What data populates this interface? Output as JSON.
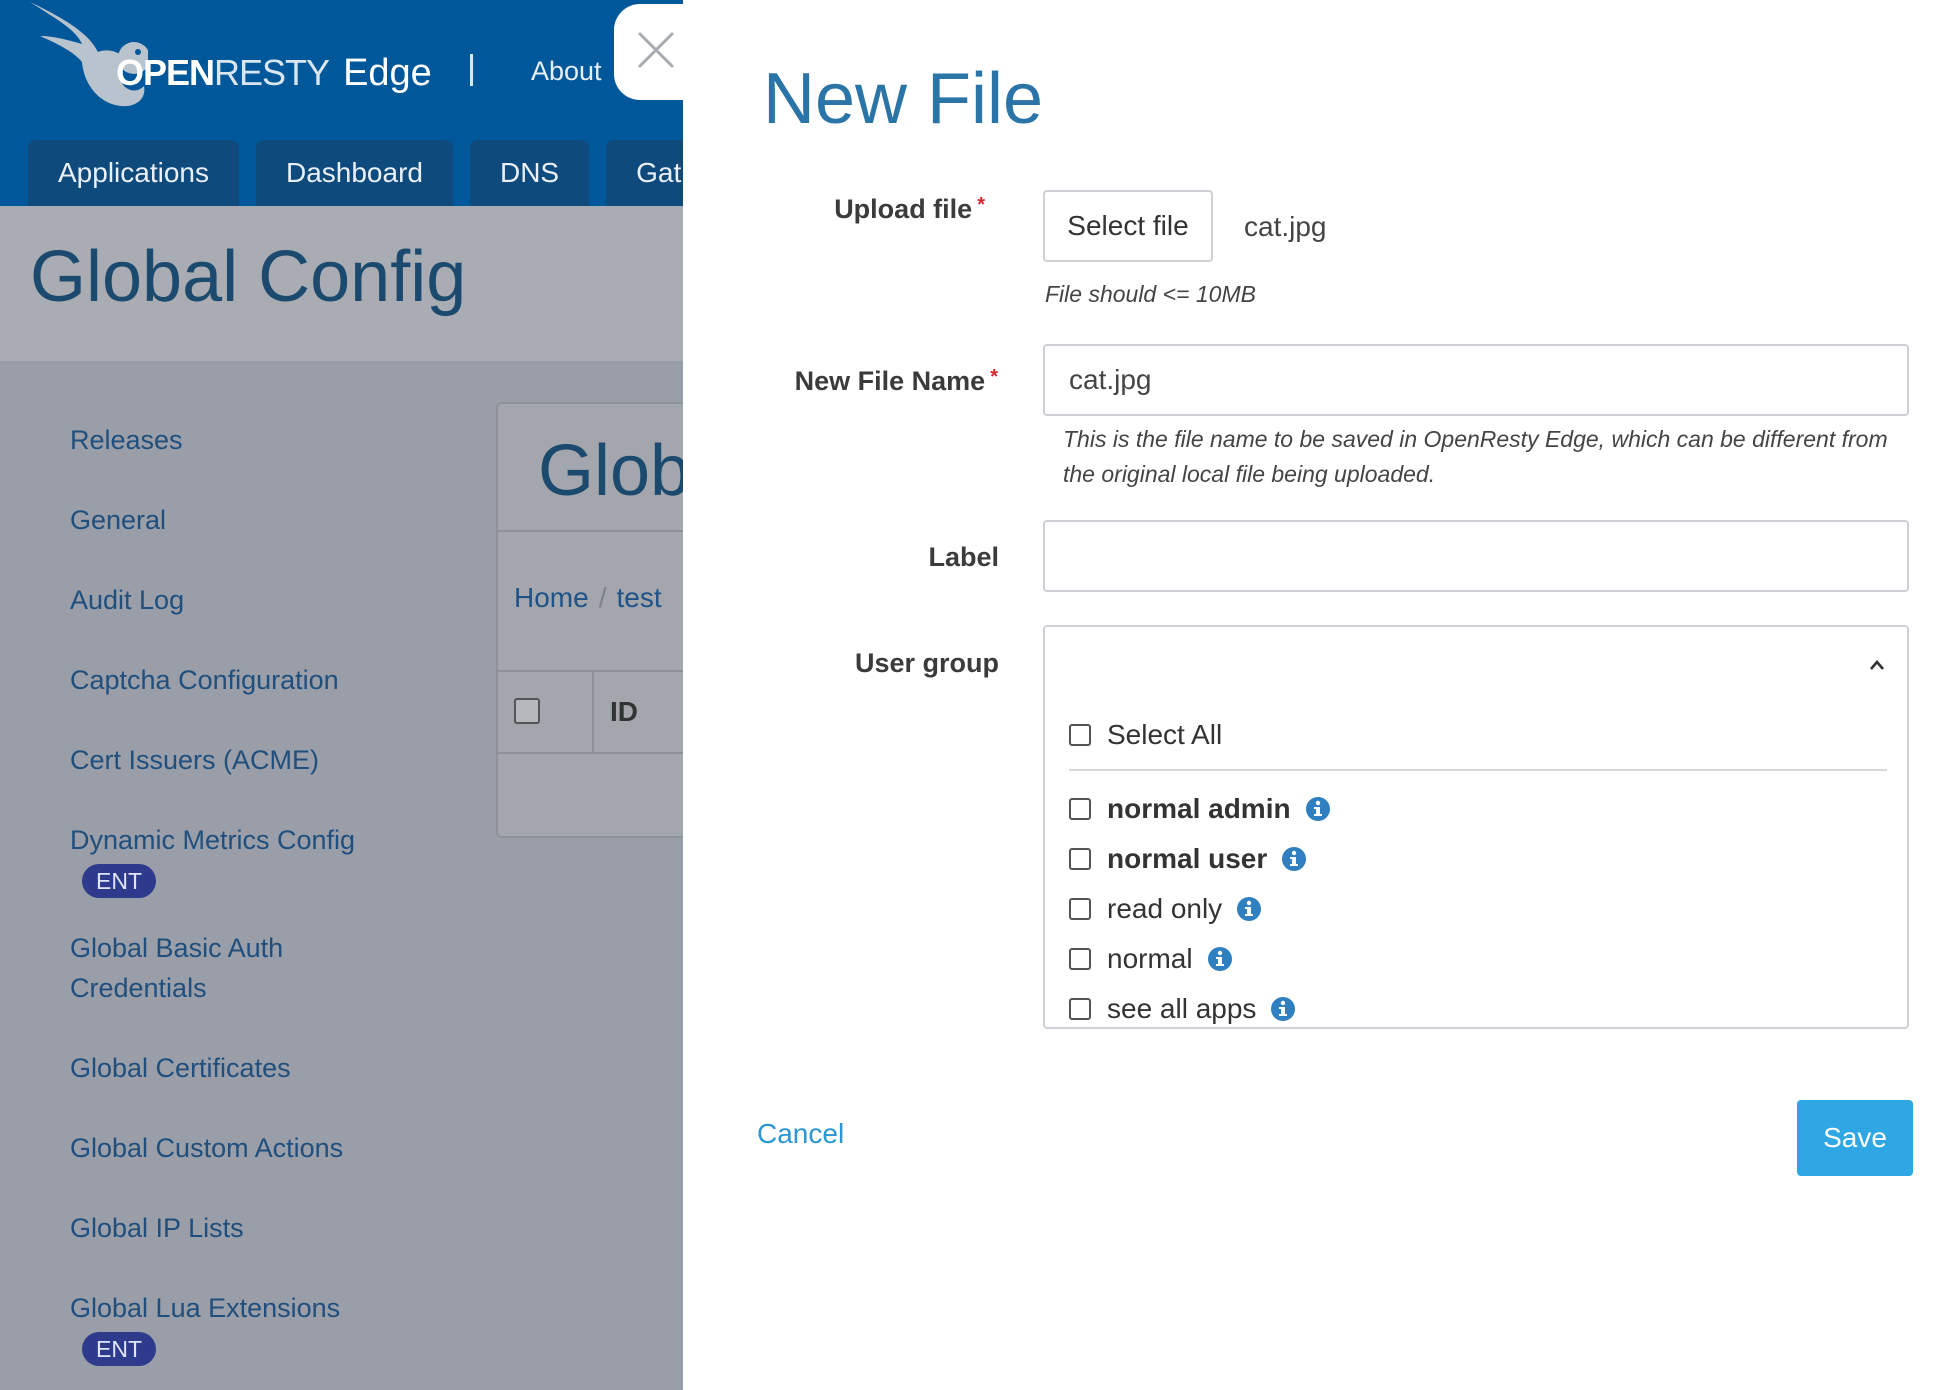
{
  "header": {
    "logo": {
      "open": "OPEN",
      "resty": "RESTY",
      "edge": "Edge"
    },
    "about_label": "About",
    "tabs": [
      "Applications",
      "Dashboard",
      "DNS",
      "Gat"
    ]
  },
  "page_title": "Global Config",
  "sidebar": {
    "items": [
      {
        "label": "Releases"
      },
      {
        "label": "General"
      },
      {
        "label": "Audit Log"
      },
      {
        "label": "Captcha Configuration"
      },
      {
        "label": "Cert Issuers (ACME)"
      },
      {
        "label": "Dynamic Metrics Config",
        "badge": "ENT"
      },
      {
        "label_line1": "Global Basic Auth",
        "label_line2": "Credentials"
      },
      {
        "label": "Global Certificates"
      },
      {
        "label": "Global Custom Actions"
      },
      {
        "label": "Global IP Lists"
      },
      {
        "label": "Global Lua Extensions",
        "badge": "ENT"
      }
    ]
  },
  "panel": {
    "title": "Glob",
    "breadcrumb": {
      "home": "Home",
      "sep": "/",
      "current": "test"
    },
    "table": {
      "id_header": "ID"
    }
  },
  "modal": {
    "title": "New File",
    "required_mark": "*",
    "upload": {
      "label": "Upload file",
      "button": "Select file",
      "selected_file": "cat.jpg",
      "hint": "File should <= 10MB"
    },
    "new_file_name": {
      "label": "New File Name",
      "value": "cat.jpg",
      "hint_line1": "This is the file name to be saved in OpenResty Edge, which can be different from",
      "hint_line2": "the original local file being uploaded."
    },
    "label_field": {
      "label": "Label",
      "value": ""
    },
    "user_group": {
      "label": "User group",
      "select_all": "Select All",
      "options": [
        "normal admin",
        "normal user",
        "read only",
        "normal",
        "see all apps"
      ]
    },
    "cancel": "Cancel",
    "save": "Save"
  },
  "colors": {
    "header_bg": "#00579a",
    "accent": "#2b74a8",
    "save_button": "#2ea7e4",
    "required": "#d9262c",
    "info_icon": "#2f7fc1"
  }
}
